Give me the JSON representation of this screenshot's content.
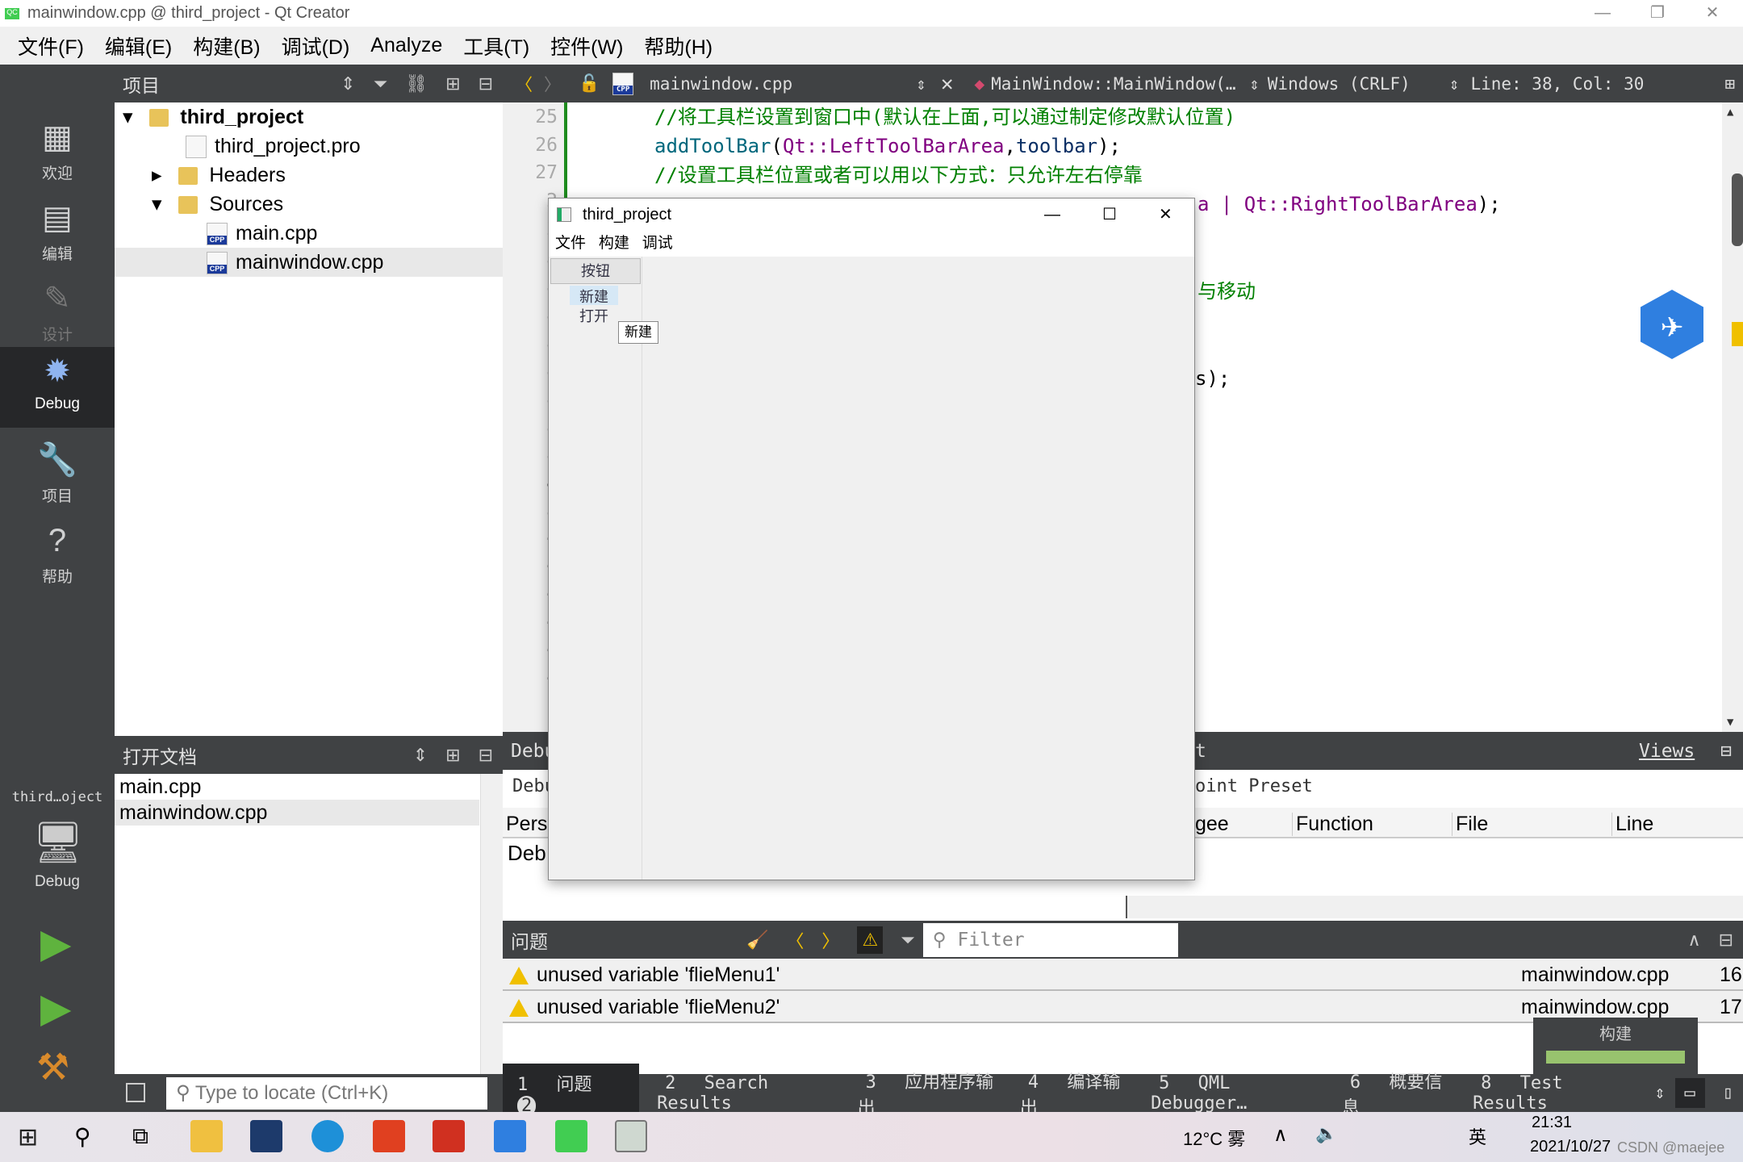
{
  "window": {
    "title": "mainwindow.cpp @ third_project - Qt Creator"
  },
  "menu": [
    "文件(F)",
    "编辑(E)",
    "构建(B)",
    "调试(D)",
    "Analyze",
    "工具(T)",
    "控件(W)",
    "帮助(H)"
  ],
  "modes": [
    {
      "label": "欢迎",
      "icon": "grid-icon"
    },
    {
      "label": "编辑",
      "icon": "document-icon"
    },
    {
      "label": "设计",
      "icon": "pencil-icon"
    },
    {
      "label": "Debug",
      "icon": "bug-icon"
    },
    {
      "label": "项目",
      "icon": "wrench-icon"
    },
    {
      "label": "帮助",
      "icon": "help-icon"
    }
  ],
  "kit": {
    "project": "third…oject",
    "config": "Debug"
  },
  "project_pane": {
    "title": "项目",
    "tree": [
      "third_project",
      "third_project.pro",
      "Headers",
      "Sources",
      "main.cpp",
      "mainwindow.cpp"
    ]
  },
  "open_docs": {
    "title": "打开文档",
    "items": [
      "main.cpp",
      "mainwindow.cpp"
    ]
  },
  "locate": {
    "placeholder": "Type to locate (Ctrl+K)"
  },
  "editor_bar": {
    "file": "mainwindow.cpp",
    "symbol": "MainWindow::MainWindow(…",
    "line_ending": "Windows (CRLF)",
    "position": "Line: 38, Col: 30"
  },
  "code": {
    "line_numbers": [
      "25",
      "26",
      "27",
      "2",
      "2",
      "3",
      "3",
      "3",
      "3",
      "3",
      "3",
      "3",
      "3",
      "3",
      "3",
      "4",
      "4",
      "4",
      "4",
      "4",
      "4"
    ],
    "line25": "//将工具栏设置到窗口中(默认在上面,可以通过制定修改默认位置)",
    "line26_fn": "addToolBar",
    "line26_arg1": "Qt::LeftToolBarArea",
    "line26_arg2": "toolbar",
    "line27": "//设置工具栏位置或者可以用以下方式：只允许左右停靠",
    "line28_a": "a | ",
    "line28_b": "Qt::RightToolBarArea",
    "line28_c": ");",
    "line31": "与移动",
    "line34": "s);"
  },
  "debug_pane": {
    "header": "Debu",
    "header_right": "t",
    "views": "Views",
    "row1": "Debu",
    "row1_right": "oint Preset",
    "col_left": "Pers",
    "col_gee": "gee",
    "columns": [
      "Function",
      "File",
      "Line"
    ],
    "cell": "Deb"
  },
  "issues": {
    "title": "问题",
    "filter_placeholder": "Filter",
    "rows": [
      {
        "text": "unused variable 'flieMenu1'",
        "file": "mainwindow.cpp",
        "line": "16"
      },
      {
        "text": "unused variable 'flieMenu2'",
        "file": "mainwindow.cpp",
        "line": "17"
      }
    ]
  },
  "build_popup": {
    "label": "构建",
    "progress": 1.0
  },
  "output_tabs": [
    {
      "num": "1",
      "label": "问题",
      "badge": "2"
    },
    {
      "num": "2",
      "label": "Search Results"
    },
    {
      "num": "3",
      "label": "应用程序输出"
    },
    {
      "num": "4",
      "label": "编译输出"
    },
    {
      "num": "5",
      "label": "QML Debugger…"
    },
    {
      "num": "6",
      "label": "概要信息"
    },
    {
      "num": "8",
      "label": "Test Results"
    }
  ],
  "app_window": {
    "title": "third_project",
    "menu": [
      "文件",
      "构建",
      "调试"
    ],
    "toolbar_button": "按钮",
    "toolbar_items": [
      "新建",
      "打开"
    ],
    "tooltip": "新建"
  },
  "taskbar": {
    "weather": "12°C 雾",
    "ime": "英",
    "time": "21:31",
    "date": "2021/10/27",
    "watermark": "CSDN @maejee"
  },
  "colors": {
    "accent": "#1e8c1e",
    "warning": "#f0c000",
    "dark": "#404244",
    "progress": "#98c36e"
  }
}
